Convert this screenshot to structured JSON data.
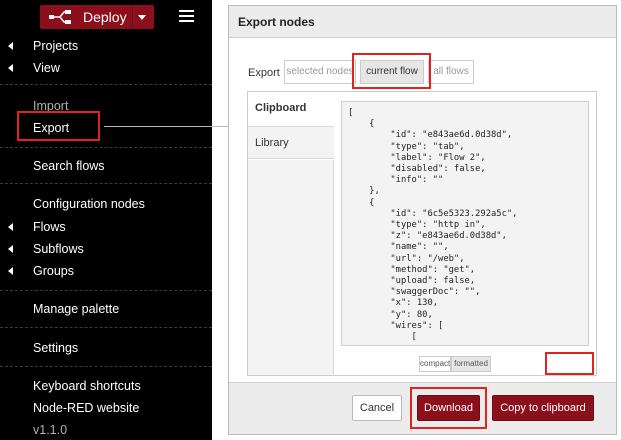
{
  "menu": {
    "deploy_label": "Deploy",
    "items": {
      "projects": "Projects",
      "view": "View",
      "import": "Import",
      "export": "Export",
      "search_flows": "Search flows",
      "configuration_nodes": "Configuration nodes",
      "flows": "Flows",
      "subflows": "Subflows",
      "groups": "Groups",
      "manage_palette": "Manage palette",
      "settings": "Settings",
      "keyboard_shortcuts": "Keyboard shortcuts",
      "website": "Node-RED website",
      "version": "v1.1.0"
    }
  },
  "dialog": {
    "title": "Export nodes",
    "export_label": "Export",
    "scope_options": {
      "selected_nodes": "selected nodes",
      "current_flow": "current flow",
      "all_flows": "all flows"
    },
    "selected_scope": "current flow",
    "tabs": {
      "clipboard": "Clipboard",
      "library": "Library"
    },
    "json_lines": [
      "[",
      "    {",
      "        \"id\": \"e843ae6d.0d38d\",",
      "        \"type\": \"tab\",",
      "        \"label\": \"Flow 2\",",
      "        \"disabled\": false,",
      "        \"info\": \"\"",
      "    },",
      "    {",
      "        \"id\": \"6c5e5323.292a5c\",",
      "        \"type\": \"http in\",",
      "        \"z\": \"e843ae6d.0d38d\",",
      "        \"name\": \"\",",
      "        \"url\": \"/web\",",
      "        \"method\": \"get\",",
      "        \"upload\": false,",
      "        \"swaggerDoc\": \"\",",
      "        \"x\": 130,",
      "        \"y\": 80,",
      "        \"wires\": [",
      "            ["
    ],
    "format": {
      "compact": "compact",
      "formatted": "formatted",
      "selected": "formatted"
    },
    "buttons": {
      "cancel": "Cancel",
      "download": "Download",
      "copy": "Copy to clipboard"
    }
  },
  "colors": {
    "accent": "#8c101c",
    "highlight": "#e0231f",
    "menu_bg": "#000000"
  }
}
